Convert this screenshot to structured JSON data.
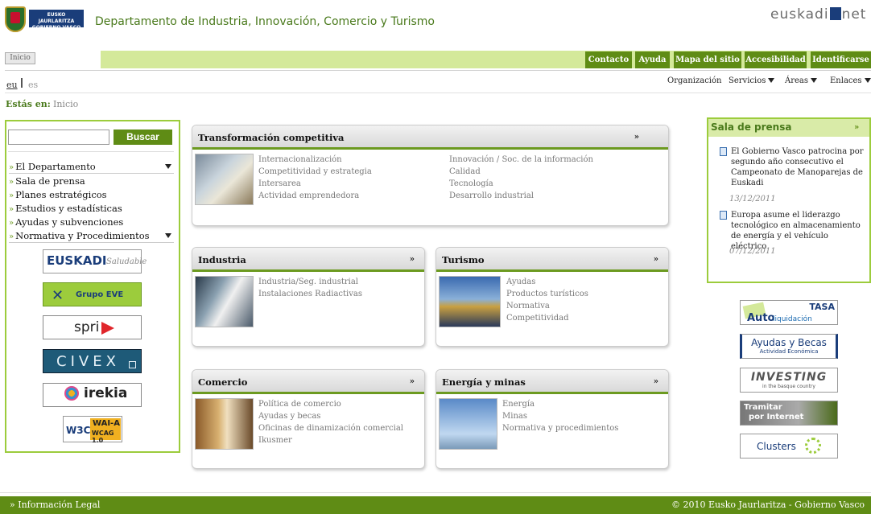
{
  "header": {
    "gov_badge_line1": "EUSKO JAURLARITZA",
    "gov_badge_line2": "GOBIERNO VASCO",
    "department_title": "Departamento de Industria, Innovación, Comercio y Turismo",
    "portal_logo_left": "euskadi",
    "portal_logo_right": "net"
  },
  "topnav": {
    "home": "Inicio",
    "buttons": [
      "Contacto",
      "Ayuda",
      "Mapa del sitio",
      "Accesibilidad",
      "Identificarse"
    ]
  },
  "lang": {
    "eu": "eu",
    "es": "es"
  },
  "menu": {
    "items": [
      "Organización",
      "Servicios",
      "Áreas",
      "Enlaces"
    ]
  },
  "breadcrumb": {
    "label": "Estás en:",
    "current": "Inicio"
  },
  "search": {
    "button": "Buscar",
    "value": ""
  },
  "leftnav": {
    "items": [
      "El Departamento",
      "Sala de prensa",
      "Planes estratégicos",
      "Estudios y estadísticas",
      "Ayudas y subvenciones",
      "Normativa y Procedimientos"
    ]
  },
  "left_logos": {
    "euskadi_saludable_a": "EUSKADI",
    "euskadi_saludable_b": "Saludable",
    "grupo_eve": "Grupo EVE",
    "spri": "spri",
    "civex": "CIVEX",
    "irekia": "irekia",
    "w3c": "W3C",
    "wai_a": "WAI-A",
    "wcag": "WCAG 1.0"
  },
  "boxes": {
    "transformacion": {
      "title": "Transformación competitiva",
      "arrow": "»",
      "col1": [
        "Internacionalización",
        "Competitividad y estrategia",
        "Intersarea",
        "Actividad emprendedora"
      ],
      "col2": [
        "Innovación / Soc. de la información",
        "Calidad",
        "Tecnología",
        "Desarrollo industrial"
      ]
    },
    "industria": {
      "title": "Industria",
      "arrow": "»",
      "links": [
        "Industria/Seg. industrial",
        "Instalaciones Radiactivas"
      ]
    },
    "turismo": {
      "title": "Turismo",
      "arrow": "»",
      "links": [
        "Ayudas",
        "Productos turísticos",
        "Normativa",
        "Competitividad"
      ]
    },
    "comercio": {
      "title": "Comercio",
      "arrow": "»",
      "links": [
        "Política de comercio",
        "Ayudas y becas",
        "Oficinas de dinamización comercial",
        "Ikusmer"
      ]
    },
    "energia": {
      "title": "Energía y minas",
      "arrow": "»",
      "links": [
        "Energía",
        "Minas",
        "Normativa y procedimientos"
      ]
    }
  },
  "press": {
    "title": "Sala de prensa",
    "arrow": "»",
    "news": [
      {
        "text": "El Gobierno Vasco patrocina por segundo año consecutivo el Campeonato de Manoparejas de Euskadi",
        "date": "13/12/2011"
      },
      {
        "text": "Europa asume el liderazgo tecnológico en almacenamiento de energía y el vehículo eléctrico",
        "date": "07/12/2011"
      }
    ]
  },
  "right_logos": {
    "tasa_top": "TASA",
    "tasa_auto": "Auto",
    "tasa_liq": "liquidación",
    "ayudas_becas": "Ayudas y Becas",
    "ayudas_sub": "Actividad Económica",
    "investing": "INVESTING",
    "investing_sub": "in the basque country",
    "tramitar": "Tramitar",
    "tramitar2": "por Internet",
    "clusters": "Clusters"
  },
  "footer": {
    "legal": "Información Legal",
    "copyright": "© 2010 Eusko Jaurlaritza - Gobierno Vasco"
  },
  "colors": {
    "accent": "#5f8c15",
    "band": "#d4e99a",
    "border": "#9ccc3c"
  }
}
